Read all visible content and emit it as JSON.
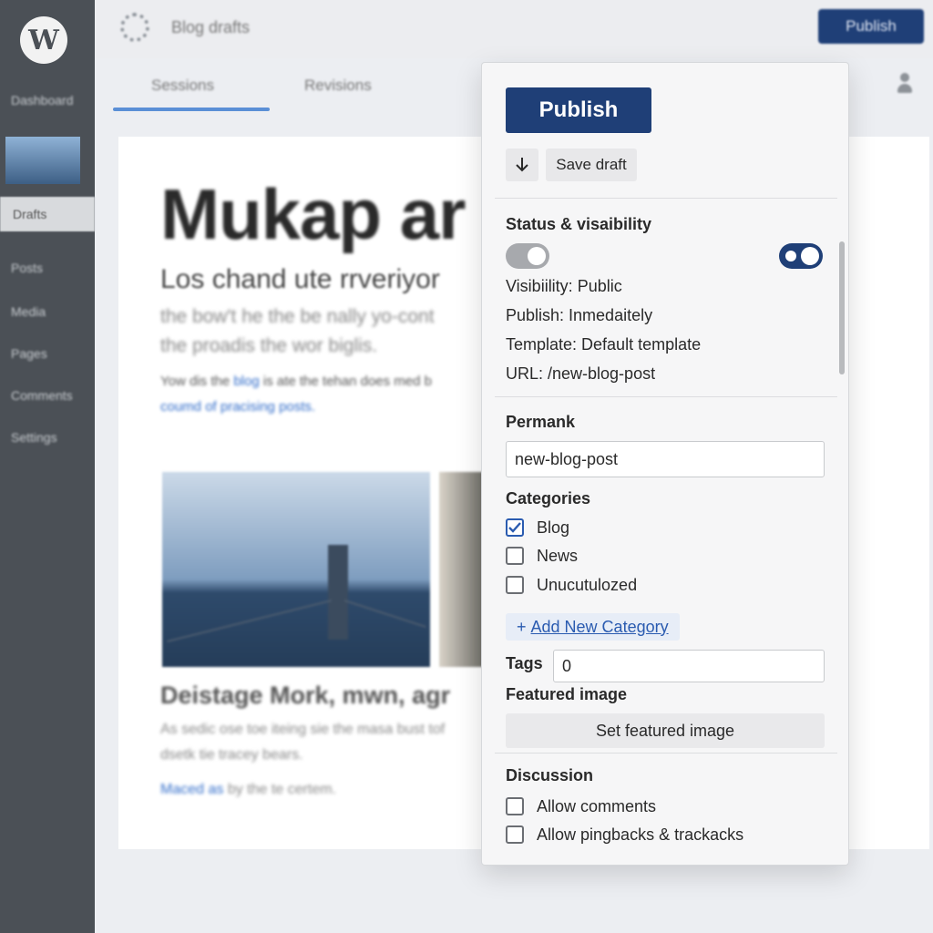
{
  "app": {
    "logo_letter": "W",
    "title": "Blog drafts"
  },
  "sidebar": {
    "items": [
      {
        "label": "Dashboard"
      },
      {
        "label": "Posts"
      },
      {
        "label": "Media"
      },
      {
        "label": "Pages"
      },
      {
        "label": "Comments"
      },
      {
        "label": "Settings"
      }
    ],
    "active_label": "Drafts"
  },
  "topbar": {
    "publish_label": "Publish"
  },
  "editor": {
    "tabs": [
      {
        "label": "Sessions"
      },
      {
        "label": "Revisions"
      }
    ],
    "post": {
      "title": "Mukap ar",
      "subtitle": "Los chand ute rrveriyor",
      "para_line1": "the bow't he the be nally yo-cont",
      "para_line2": "the proadis the wor biglis.",
      "link_prefix": "Yow dis the ",
      "link_word": "blog",
      "link_suffix": " is ate the tehan does med b",
      "link_line2": "coumd of pracising posts.",
      "caption_title": "Deistage Mork, mwn, agr",
      "caption_line1": "As sedic ose toe iteing sie the masa bust tof",
      "caption_line2": "dsetk tie tracey bears.",
      "foot_link": "Maced as",
      "foot_rest": " by the te certem."
    }
  },
  "panel": {
    "publish_label": "Publish",
    "save_draft_label": "Save draft",
    "status_heading": "Status & visaibility",
    "visibility": "Visibiility: Public",
    "publish_when": "Publish: Inmedaitely",
    "template": "Template: Default template",
    "url": "URL: /new-blog-post",
    "permalink_heading": "Permank",
    "permalink_value": "new-blog-post",
    "categories_heading": "Categories",
    "categories": [
      {
        "label": "Blog",
        "checked": true
      },
      {
        "label": "News",
        "checked": false
      },
      {
        "label": "Unucutulozed",
        "checked": false
      }
    ],
    "add_category_plus": "+",
    "add_category_label": "Add New Category",
    "tags_label": "Tags",
    "tags_value": "0",
    "featured_heading": "Featured image",
    "featured_button": "Set featured image",
    "discussion_heading": "Discussion",
    "discussion": [
      {
        "label": "Allow comments",
        "checked": false
      },
      {
        "label": "Allow pingbacks & trackacks",
        "checked": false
      }
    ]
  },
  "colors": {
    "primary": "#1f3f77",
    "link": "#2a5bb0",
    "sidebar_bg": "#4b5056"
  },
  "icons": {
    "logo": "wordpress-logo-icon",
    "settings": "gear-icon",
    "user": "user-icon",
    "download": "arrow-down-icon",
    "check": "checkmark-icon"
  }
}
